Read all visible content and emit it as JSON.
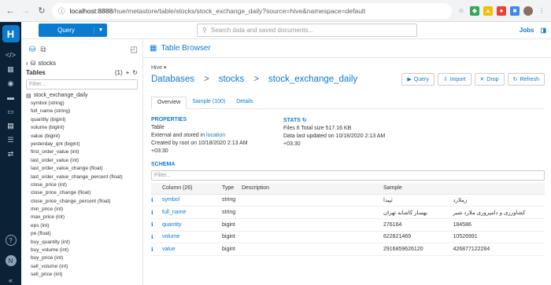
{
  "browser": {
    "url_host": "localhost:8888",
    "url_path": "/hue/metastore/table/stocks/stock_exchange_daily?source=hive&namespace=default"
  },
  "topbar": {
    "query_label": "Query",
    "search_placeholder": "Search data and saved documents...",
    "jobs_label": "Jobs"
  },
  "assist": {
    "database": "stocks",
    "tables_label": "Tables",
    "tables_count": "(1)",
    "filter_placeholder": "Filter...",
    "table_name": "stock_exchange_daily",
    "columns": [
      "symbol (string)",
      "full_name (string)",
      "quantity (bigint)",
      "volume (bigint)",
      "value (bigint)",
      "yesterday_qnt (bigint)",
      "first_order_value (int)",
      "last_order_value (int)",
      "last_order_value_change (float)",
      "last_order_value_change_percent (float)",
      "close_price (int)",
      "close_price_change (float)",
      "close_price_change_percent (float)",
      "min_price (int)",
      "max_price (int)",
      "eps (int)",
      "pe (float)",
      "buy_quantity (int)",
      "buy_volume (int)",
      "buy_price (int)",
      "sell_volume (int)",
      "sell_price (int)"
    ]
  },
  "panel": {
    "title": "Table Browser",
    "source": "Hive",
    "crumbs": [
      "Databases",
      "stocks",
      "stock_exchange_daily"
    ],
    "actions": [
      "Query",
      "Import",
      "Drop",
      "Refresh"
    ],
    "tabs": [
      "Overview",
      "Sample (100)",
      "Details"
    ],
    "properties": {
      "title": "PROPERTIES",
      "type": "Table",
      "stored_prefix": "External and stored in ",
      "stored_link": "location",
      "created": "Created by root on 10/18/2020 2:13 AM",
      "tz": "+03:30"
    },
    "stats": {
      "title": "STATS",
      "files": "Files  6   Total size  517.16 KB",
      "updated": "Data last updated on 10/18/2020 2:13 AM",
      "tz": "+03:30"
    },
    "schema": {
      "title": "SCHEMA",
      "filter_placeholder": "Filter...",
      "headers": [
        "Column (26)",
        "Type",
        "Description",
        "Sample"
      ],
      "rows": [
        {
          "name": "symbol",
          "type": "string",
          "s1": "ثپیدا",
          "s2": "زملارد"
        },
        {
          "name": "full_name",
          "type": "string",
          "s1": "بهساز کاشانه تهران",
          "s2": "کشاورزی و دامپروری ملارد شیر"
        },
        {
          "name": "quantity",
          "type": "bigint",
          "s1": "276164",
          "s2": "184586"
        },
        {
          "name": "volume",
          "type": "bigint",
          "s1": "622821469",
          "s2": "10526991"
        },
        {
          "name": "value",
          "type": "bigint",
          "s1": "2916859626120",
          "s2": "426877122284"
        }
      ]
    }
  }
}
